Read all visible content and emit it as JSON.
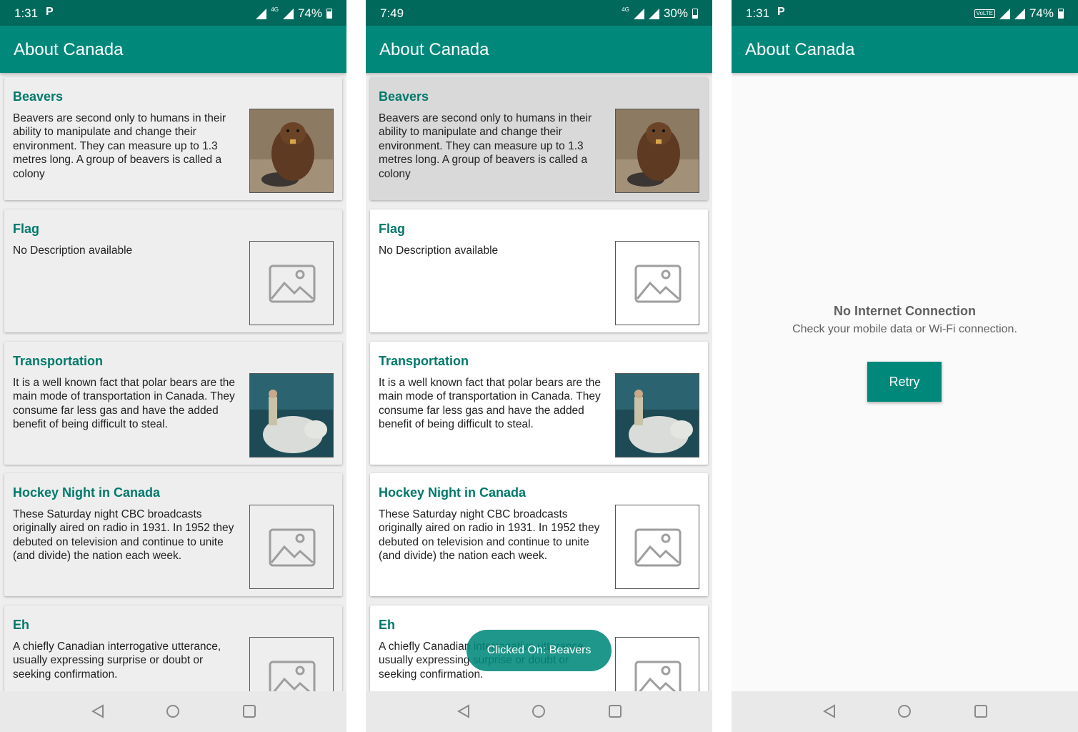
{
  "app_title": "About Canada",
  "colors": {
    "primary": "#00897b",
    "primary_dark": "#00695c",
    "accent_text": "#00796b",
    "selected_card": "#d9d9d9"
  },
  "phones": [
    {
      "status": {
        "time": "1:31",
        "notification": "P",
        "network": "4G",
        "battery": "74%"
      }
    },
    {
      "status": {
        "time": "7:49",
        "network": "4G",
        "battery": "30%"
      }
    },
    {
      "status": {
        "time": "1:31",
        "notification": "P",
        "volte": "VoLTE",
        "battery": "74%"
      }
    }
  ],
  "cards": [
    {
      "title": "Beavers",
      "description": "Beavers are second only to humans in their ability to manipulate and change their environment. They can measure up to 1.3 metres long. A group of beavers is called a colony",
      "image": "beaver-photo"
    },
    {
      "title": "Flag",
      "description": "No Description available",
      "image": "image-placeholder-icon"
    },
    {
      "title": "Transportation",
      "description": "It is a well known fact that polar bears are the main mode of transportation in Canada. They consume far less gas and have the added benefit of being difficult to steal.",
      "image": "polar-bear-rider-photo"
    },
    {
      "title": "Hockey Night in Canada",
      "description": "These Saturday night CBC broadcasts originally aired on radio in 1931. In 1952 they debuted on television and continue to unite (and divide) the nation each week.",
      "image": "image-placeholder-icon"
    },
    {
      "title": "Eh",
      "description": "A chiefly Canadian interrogative utterance, usually expressing surprise or doubt or seeking confirmation.",
      "image": "image-placeholder-icon"
    }
  ],
  "toast": "Clicked On: Beavers",
  "error": {
    "title": "No Internet Connection",
    "subtitle": "Check your mobile data or Wi-Fi connection.",
    "retry_label": "Retry"
  },
  "navbar": {
    "icons": [
      "back-icon",
      "home-icon",
      "recents-icon"
    ]
  }
}
